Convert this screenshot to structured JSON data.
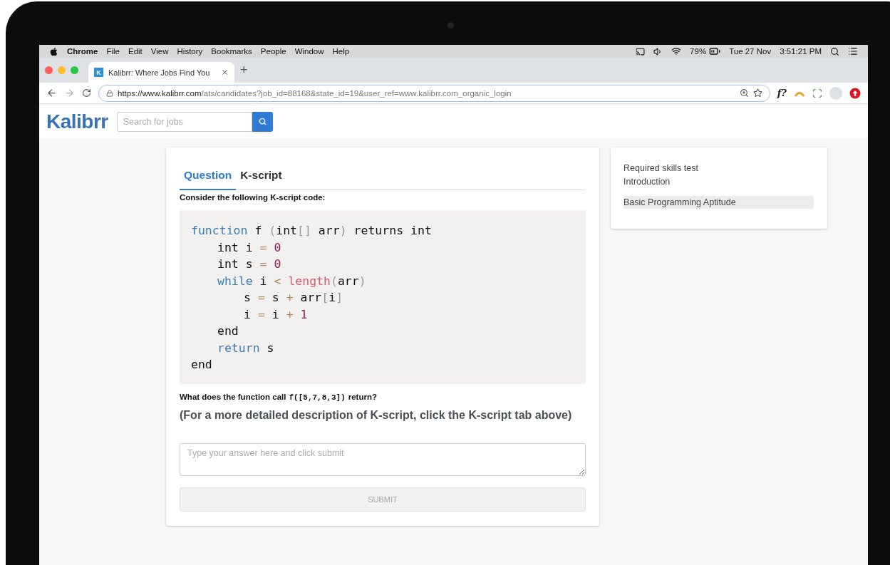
{
  "menu_bar": {
    "app": "Chrome",
    "items": [
      "File",
      "Edit",
      "View",
      "History",
      "Bookmarks",
      "People",
      "Window",
      "Help"
    ],
    "battery": "79%",
    "date": "Tue 27 Nov",
    "time": "3:51:21 PM"
  },
  "browser_tabs": [
    {
      "title": "Kalibrr: Where Jobs Find You",
      "favicon": "K",
      "selected": true
    }
  ],
  "new_tab": "+",
  "address": {
    "host": "https://www.kalibrr.com",
    "path": "/ats/candidates?job_id=88168&state_id=19&user_ref=www.kalibrr.com_organic_login"
  },
  "extensions": {
    "formula": "f?"
  },
  "site_header": {
    "logo": "Kalibrr",
    "search": {
      "placeholder": "Search for jobs"
    }
  },
  "question_card": {
    "tabs": [
      {
        "label": "Question",
        "selected": true
      },
      {
        "label": "K-script",
        "selected": false
      }
    ],
    "prompt": "Consider the following K-script code:",
    "code": [
      {
        "tokens": [
          {
            "kind": "keyword",
            "text": "function"
          },
          {
            "kind": "plain",
            "text": " f "
          },
          {
            "kind": "bracket",
            "text": "("
          },
          {
            "kind": "plain",
            "text": "int"
          },
          {
            "kind": "bracket",
            "text": "[]"
          },
          {
            "kind": "plain",
            "text": " arr"
          },
          {
            "kind": "bracket",
            "text": ")"
          },
          {
            "kind": "plain",
            "text": " returns int"
          }
        ],
        "children": [
          {
            "tokens": [
              {
                "kind": "plain",
                "text": "int i "
              },
              {
                "kind": "operator",
                "text": "="
              },
              {
                "kind": "number",
                "text": " 0"
              }
            ]
          },
          {
            "tokens": [
              {
                "kind": "plain",
                "text": "int s "
              },
              {
                "kind": "operator",
                "text": "="
              },
              {
                "kind": "number",
                "text": " 0"
              }
            ]
          },
          {
            "tokens": [
              {
                "kind": "keyword",
                "text": "while"
              },
              {
                "kind": "plain",
                "text": " i "
              },
              {
                "kind": "operator",
                "text": "<"
              },
              {
                "kind": "builtin",
                "text": " length"
              },
              {
                "kind": "bracket",
                "text": "("
              },
              {
                "kind": "plain",
                "text": "arr"
              },
              {
                "kind": "bracket",
                "text": ")"
              }
            ],
            "children": [
              {
                "tokens": [
                  {
                    "kind": "plain",
                    "text": "s "
                  },
                  {
                    "kind": "operator",
                    "text": "="
                  },
                  {
                    "kind": "plain",
                    "text": " s "
                  },
                  {
                    "kind": "operator",
                    "text": "+"
                  },
                  {
                    "kind": "plain",
                    "text": " arr"
                  },
                  {
                    "kind": "bracket",
                    "text": "["
                  },
                  {
                    "kind": "plain",
                    "text": "i"
                  },
                  {
                    "kind": "bracket",
                    "text": "]"
                  }
                ]
              },
              {
                "tokens": [
                  {
                    "kind": "plain",
                    "text": "i "
                  },
                  {
                    "kind": "operator",
                    "text": "="
                  },
                  {
                    "kind": "plain",
                    "text": " i "
                  },
                  {
                    "kind": "operator",
                    "text": "+"
                  },
                  {
                    "kind": "number",
                    "text": " 1"
                  }
                ]
              }
            ]
          },
          {
            "tokens": [
              {
                "kind": "plain",
                "text": "end"
              }
            ]
          },
          {
            "tokens": [
              {
                "kind": "keyword",
                "text": "return"
              },
              {
                "kind": "plain",
                "text": " s"
              }
            ]
          }
        ]
      },
      {
        "tokens": [
          {
            "kind": "plain",
            "text": "end"
          }
        ]
      }
    ],
    "question": {
      "before": "What does the function call",
      "code": "f([5,7,8,3])",
      "after": "return?"
    },
    "note": "(For a more detailed description of K-script, click the K-script tab above)",
    "answer": {
      "placeholder": "Type your answer here and click submit"
    },
    "submit": {
      "label": "SUBMIT",
      "disabled": true
    }
  },
  "sections": [
    {
      "label": "Required skills test",
      "selected": false
    },
    {
      "label": "Introduction",
      "selected": false
    },
    {
      "label": "Basic Programming Aptitude",
      "selected": true
    }
  ]
}
